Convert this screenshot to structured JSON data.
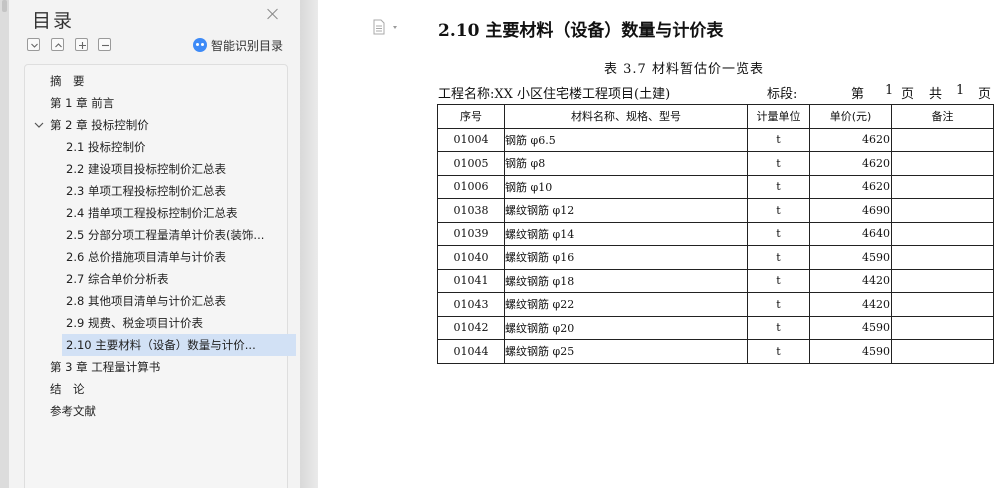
{
  "nav": {
    "title": "目录",
    "smart_toc_label": "智能识别目录",
    "items": [
      {
        "label": "摘　要",
        "level": 1
      },
      {
        "label": "第 1 章  前言",
        "level": 1
      },
      {
        "label": "第 2 章  投标控制价",
        "level": 1,
        "expanded": true
      },
      {
        "label": "2.1 投标控制价",
        "level": 2
      },
      {
        "label": "2.2 建设项目投标控制价汇总表",
        "level": 2
      },
      {
        "label": "2.3 单项工程投标控制价汇总表",
        "level": 2
      },
      {
        "label": "2.4 措单项工程投标控制价汇总表",
        "level": 2
      },
      {
        "label": "2.5 分部分项工程量清单计价表(装饰...",
        "level": 2
      },
      {
        "label": "2.6 总价措施项目清单与计价表",
        "level": 2
      },
      {
        "label": "2.7 综合单价分析表",
        "level": 2
      },
      {
        "label": "2.8  其他项目清单与计价汇总表",
        "level": 2
      },
      {
        "label": "2.9  规费、税金项目计价表",
        "level": 2
      },
      {
        "label": "2.10  主要材料（设备）数量与计价...",
        "level": 2,
        "active": true
      },
      {
        "label": "第 3 章  工程量计算书",
        "level": 1
      },
      {
        "label": "结　论",
        "level": 1
      },
      {
        "label": "参考文献",
        "level": 1
      }
    ]
  },
  "doc": {
    "heading": "2.10  主要材料（设备）数量与计价表",
    "caption": "表 3.7 材料暂估价一览表",
    "project_name": "工程名称:XX 小区住宅楼工程项目(土建)",
    "section_label": "标段:",
    "page_di": "第",
    "page_current": "1",
    "page_ye": "页",
    "page_gong": "共",
    "page_total": "1",
    "page_ye2": "页",
    "table": {
      "headers": [
        "序号",
        "材料名称、规格、型号",
        "计量单位",
        "单价(元)",
        "备注"
      ],
      "rows": [
        [
          "01004",
          "钢筋  φ6.5",
          "t",
          "4620",
          ""
        ],
        [
          "01005",
          "钢筋  φ8",
          "t",
          "4620",
          ""
        ],
        [
          "01006",
          "钢筋  φ10",
          "t",
          "4620",
          ""
        ],
        [
          "01038",
          "螺纹钢筋  φ12",
          "t",
          "4690",
          ""
        ],
        [
          "01039",
          "螺纹钢筋  φ14",
          "t",
          "4640",
          ""
        ],
        [
          "01040",
          "螺纹钢筋  φ16",
          "t",
          "4590",
          ""
        ],
        [
          "01041",
          "螺纹钢筋  φ18",
          "t",
          "4420",
          ""
        ],
        [
          "01043",
          "螺纹钢筋  φ22",
          "t",
          "4420",
          ""
        ],
        [
          "01042",
          "螺纹钢筋  φ20",
          "t",
          "4590",
          ""
        ],
        [
          "01044",
          "螺纹钢筋  φ25",
          "t",
          "4590",
          ""
        ]
      ]
    }
  },
  "colors": {
    "active_item_bg": "#d2e1f5",
    "smart_icon": "#3d8af7"
  },
  "icons": {
    "close": "close-icon",
    "collapse": "collapse-all-icon",
    "expand": "expand-all-icon",
    "add": "add-heading-icon",
    "remove": "remove-heading-icon",
    "smart": "smart-toc-icon",
    "chevron": "chevron-down-icon",
    "page": "document-page-icon"
  }
}
